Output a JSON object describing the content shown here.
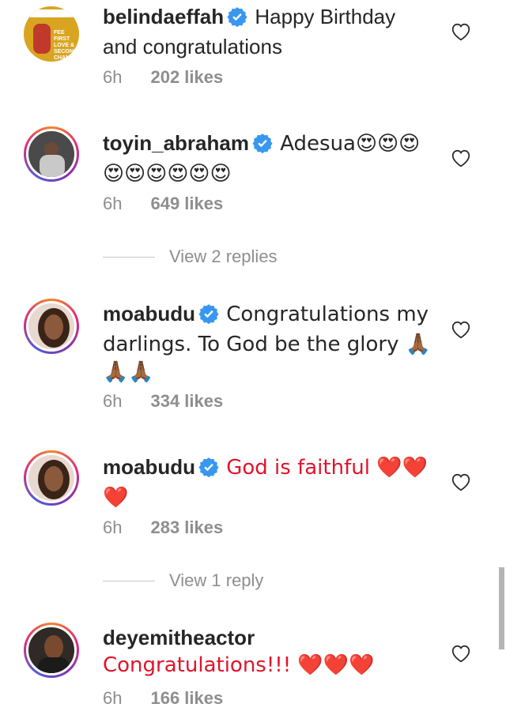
{
  "comments": [
    {
      "username": "belindaeffah",
      "verified": true,
      "text": "Happy Birthday and congratulations",
      "time": "6h",
      "likes": "202 likes",
      "avatar_text": "FEE  FIRST LOVE & SECOND CHANCE"
    },
    {
      "username": "toyin_abraham",
      "verified": true,
      "text": "Adesua😍😍😍😍😍😍😍😍😍",
      "time": "6h",
      "likes": "649 likes"
    },
    {
      "username": "moabudu",
      "verified": true,
      "text": "Congratulations my darlings. To God be the glory 🙏🏾🙏🏾🙏🏾",
      "time": "6h",
      "likes": "334 likes"
    },
    {
      "username": "moabudu",
      "verified": true,
      "text": "God is faithful ❤️❤️❤️",
      "time": "6h",
      "likes": "283 likes"
    },
    {
      "username": "deyemitheactor",
      "verified": false,
      "text": "Congratulations!!! ❤️❤️❤️",
      "time": "6h",
      "likes": "166 likes"
    }
  ],
  "replies": [
    {
      "label": "View 2 replies"
    },
    {
      "label": "View 1 reply"
    }
  ],
  "colors": {
    "verified": "#3897f0",
    "muted": "#8e8e8e",
    "text": "#262626"
  }
}
